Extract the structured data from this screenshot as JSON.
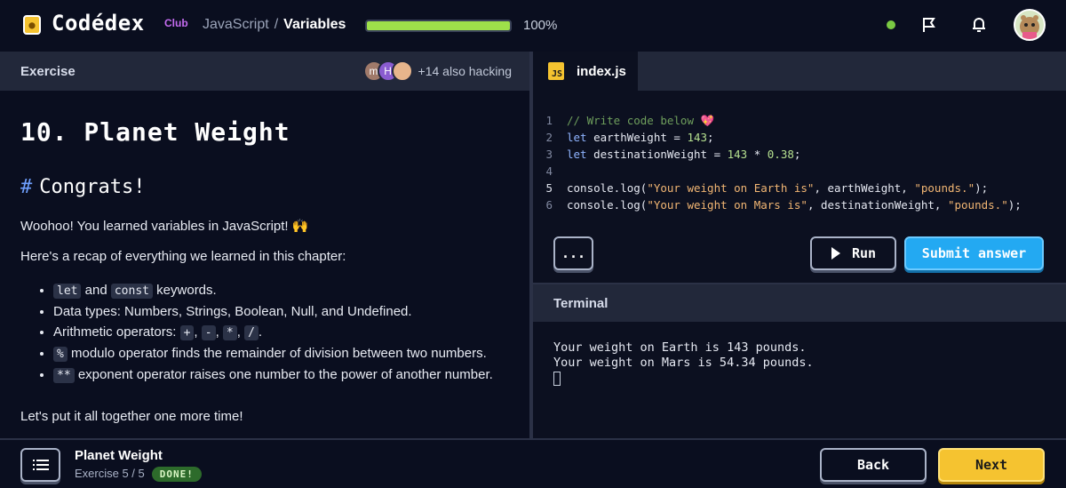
{
  "header": {
    "logo_text": "Codédex",
    "logo_badge": "Club",
    "breadcrumb": {
      "course": "JavaScript",
      "separator": "/",
      "current": "Variables"
    },
    "progress": {
      "label": "100%",
      "value": 1.0
    },
    "icons": [
      "status-dot",
      "flag-icon",
      "bell-icon",
      "avatar"
    ]
  },
  "exercise_panel": {
    "tab_label": "Exercise",
    "hackers": {
      "avatars": [
        "m",
        "H",
        ""
      ],
      "count_text": "+14 also hacking"
    },
    "title": "10. Planet Weight",
    "section_hash": "#",
    "section_title": "Congrats!",
    "intro": "Woohoo! You learned variables in JavaScript! 🙌",
    "recap_intro": "Here's a recap of everything we learned in this chapter:",
    "recap": {
      "item1": {
        "code_a": "let",
        "mid": "and",
        "code_b": "const",
        "rest": "keywords."
      },
      "item2": "Data types: Numbers, Strings, Boolean, Null, and Undefined.",
      "item3": {
        "text": "Arithmetic operators:",
        "ops": [
          "+",
          "-",
          "*",
          "/"
        ],
        "sep": ",",
        "end": "."
      },
      "item4": {
        "code": "%",
        "rest": "modulo operator finds the remainder of division between two numbers."
      },
      "item5": {
        "code": "**",
        "rest": "exponent operator raises one number to the power of another number."
      }
    },
    "closing": "Let's put it all together one more time!"
  },
  "editor": {
    "file_tab": "index.js",
    "file_badge": "JS",
    "lines": {
      "n1": "1",
      "n2": "2",
      "n3": "3",
      "n4": "4",
      "n5": "5",
      "n6": "6",
      "l1_comment": "// Write code below 💖",
      "l2_kw": "let",
      "l2_rest": " earthWeight = ",
      "l2_num": "143",
      "l2_end": ";",
      "l3_kw": "let",
      "l3_rest": " destinationWeight = ",
      "l3_num1": "143",
      "l3_op": " * ",
      "l3_num2": "0.38",
      "l3_end": ";",
      "l5_fn": "console.log(",
      "l5_str1": "\"Your weight on Earth is\"",
      "l5_mid": ", earthWeight, ",
      "l5_str2": "\"pounds.\"",
      "l5_end": ");",
      "l6_fn": "console.log(",
      "l6_str1": "\"Your weight on Mars is\"",
      "l6_mid": ", destinationWeight, ",
      "l6_str2": "\"pounds.\"",
      "l6_end": ");"
    },
    "more_button": "...",
    "run_button": "Run",
    "submit_button": "Submit answer"
  },
  "terminal": {
    "title": "Terminal",
    "output_line1": "Your weight on Earth is 143 pounds.",
    "output_line2": "Your weight on Mars is 54.34 pounds."
  },
  "footer": {
    "exercise_title": "Planet Weight",
    "exercise_progress": "Exercise 5 / 5",
    "status_badge": "DONE!",
    "back_button": "Back",
    "next_button": "Next"
  },
  "colors": {
    "background": "#0a0e1f",
    "panel_bar": "#22283a",
    "accent_blue": "#23a9f2",
    "accent_yellow": "#f5c330",
    "progress_green": "#9ee04a",
    "done_green": "#2d6b2b"
  }
}
